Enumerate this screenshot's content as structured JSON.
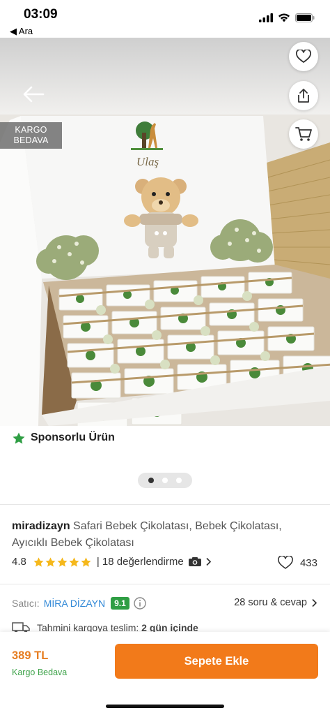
{
  "status_bar": {
    "time": "03:09",
    "back_label": "◀ Ara"
  },
  "hero": {
    "badge": "KARGO\nBEDAVA",
    "name_on_box": "Ulaş",
    "carousel_count": 3,
    "carousel_active": 0
  },
  "sponsored": {
    "label": "Sponsorlu Ürün"
  },
  "product": {
    "brand": "miradizayn",
    "name": "Safari Bebek Çikolatası, Bebek Çikolatası, Ayıcıklı Bebek Çikolatası",
    "rating": "4.8",
    "stars": 5,
    "reviews": "| 18 değerlendirme",
    "favorites": "433"
  },
  "seller": {
    "label": "Satıcı:",
    "name": "MİRA DİZAYN",
    "score": "9.1",
    "qa": "28 soru & cevap"
  },
  "delivery": {
    "prefix": "Tahmini kargoya teslim:",
    "value": "2 gün içinde"
  },
  "bottom_bar": {
    "price": "389 TL",
    "shipping": "Kargo Bedava",
    "add_to_cart": "Sepete Ekle"
  },
  "colors": {
    "accent": "#f27a1a",
    "seller_link": "#2d86d6",
    "score_bg": "#2f9e44",
    "free_shipping": "#3ea34a",
    "star": "#f5b81c"
  }
}
